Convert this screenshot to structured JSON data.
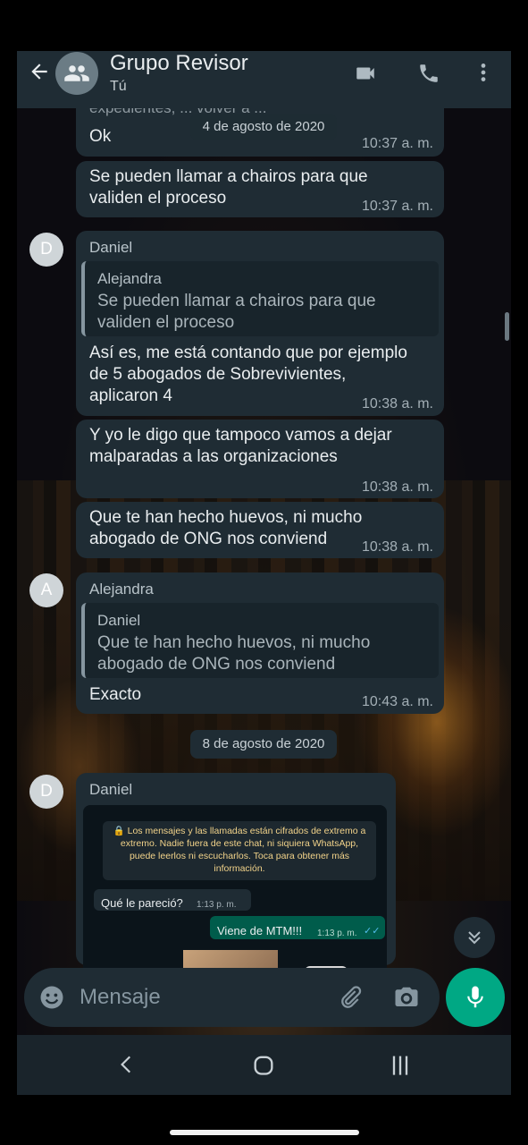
{
  "header": {
    "title": "Grupo Revisor",
    "subtitle": "Tú"
  },
  "top_cut_text": "expedientes, ... volver a ...",
  "dates": {
    "date1": "4 de agosto de 2020",
    "date2": "8 de agosto de 2020"
  },
  "messages": [
    {
      "text": "Ok",
      "time": "10:37 a. m."
    },
    {
      "text": "Se pueden llamar a chairos para que\nvaliden el proceso",
      "time": "10:37 a. m."
    },
    {
      "sender": "Daniel",
      "avatar": "D",
      "quote_name": "Alejandra",
      "quote_text": "Se pueden llamar a chairos para que\nvaliden el proceso",
      "text": "Así es, me está contando que por ejemplo\nde 5 abogados de Sobrevivientes,\naplicaron 4",
      "time": "10:38 a. m."
    },
    {
      "text": "Y yo le digo que tampoco vamos a dejar\nmalparadas a las organizaciones",
      "time": "10:38 a. m."
    },
    {
      "text": "Que te han hecho huevos, ni mucho\nabogado de ONG nos conviend",
      "time": "10:38 a. m."
    },
    {
      "sender": "Alejandra",
      "avatar": "A",
      "quote_name": "Daniel",
      "quote_text": "Que te han hecho huevos, ni mucho\nabogado de ONG nos conviend",
      "text": "Exacto",
      "time": "10:43 a. m."
    },
    {
      "sender": "Daniel",
      "avatar": "D"
    }
  ],
  "screenshot_inner": {
    "encryption_notice": "🔒 Los mensajes y las llamadas están cifrados de extremo a extremo. Nadie fuera de este chat, ni siquiera WhatsApp, puede leerlos ni escucharlos. Toca para obtener más información.",
    "msg_in": "Qué le pareció?",
    "msg_in_time": "1:13 p. m.",
    "msg_out": "Viene de MTM!!!",
    "msg_out_time": "1:13 p. m."
  },
  "input": {
    "placeholder": "Mensaje"
  },
  "colors": {
    "header_bg": "#1f2c34",
    "bubble_bg": "#1f2c34",
    "accent_green": "#00a884"
  }
}
